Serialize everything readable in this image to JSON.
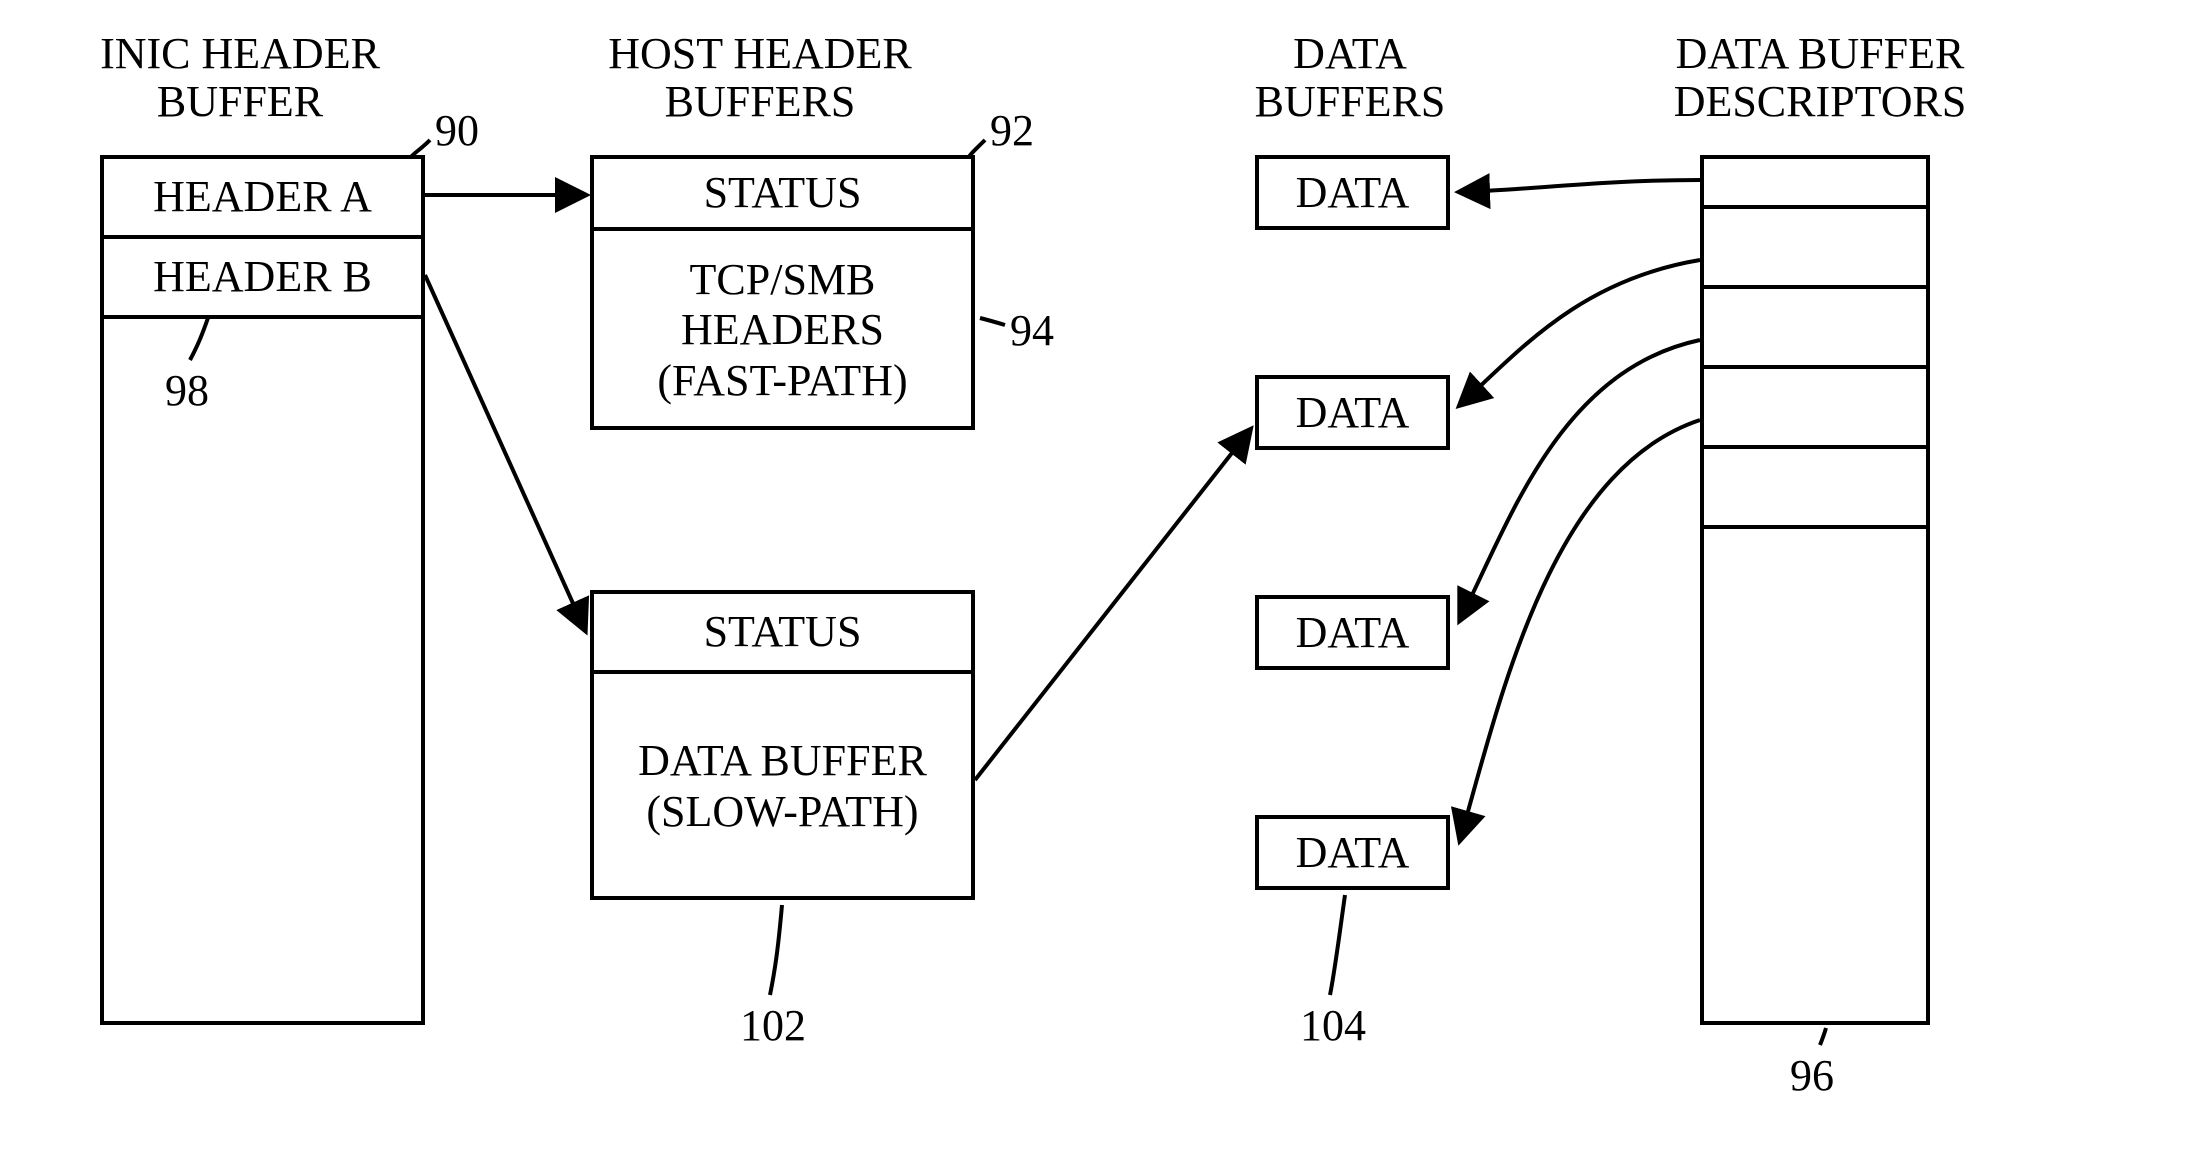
{
  "titles": {
    "inic": "INIC HEADER\nBUFFER",
    "host": "HOST HEADER\nBUFFERS",
    "data_buffers": "DATA\nBUFFERS",
    "descriptors": "DATA BUFFER\nDESCRIPTORS"
  },
  "inic_buffer": {
    "header_a": "HEADER A",
    "header_b": "HEADER B"
  },
  "host_fast": {
    "status": "STATUS",
    "body": "TCP/SMB\nHEADERS\n(FAST-PATH)"
  },
  "host_slow": {
    "status": "STATUS",
    "body": "DATA BUFFER\n(SLOW-PATH)"
  },
  "data_cells": {
    "d1": "DATA",
    "d2": "DATA",
    "d3": "DATA",
    "d4": "DATA"
  },
  "refs": {
    "r90": "90",
    "r92": "92",
    "r94": "94",
    "r96": "96",
    "r98": "98",
    "r102": "102",
    "r104": "104"
  }
}
